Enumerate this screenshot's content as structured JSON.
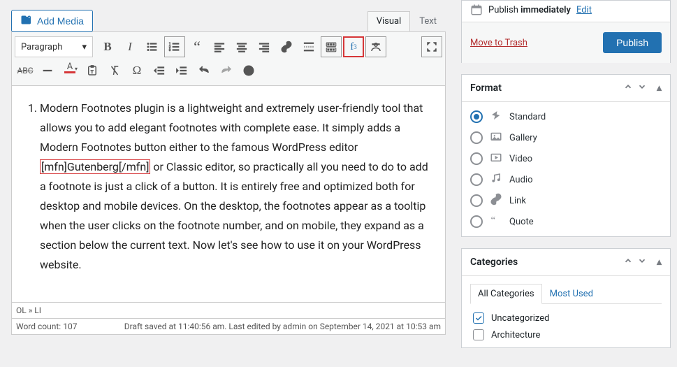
{
  "add_media_label": "Add Media",
  "editor_tabs": {
    "visual": "Visual",
    "text": "Text"
  },
  "paragraph_select": "Paragraph",
  "toolbar_icons": {
    "footnote_label": "f",
    "footnote_sup": "3"
  },
  "content": {
    "list_number": "1.",
    "text_before": "Modern Footnotes plugin is a lightweight and extremely user-friendly tool that allows you to add elegant footnotes with complete ease. It simply adds a Modern Footnotes button either to the famous WordPress editor ",
    "highlight": "[mfn]Gutenberg[/mfn]",
    "text_after": " or Classic editor, so practically all you need to do to add a footnote is just a click of a button. It is entirely free and optimized both for desktop and mobile devices. On the desktop, the footnotes appear as a tooltip when the user clicks on the footnote number, and on mobile, they expand as a section below the current text. Now let's see how to use it on your WordPress website."
  },
  "status": {
    "path": "OL » LI",
    "wordcount_label": "Word count:",
    "wordcount_value": "107",
    "save_info": "Draft saved at 11:40:56 am. Last edited by admin on September 14, 2021 at 10:53 am"
  },
  "publish": {
    "label_prefix": "Publish ",
    "label_value": "immediately",
    "edit": "Edit",
    "trash": "Move to Trash",
    "button": "Publish"
  },
  "format": {
    "title": "Format",
    "items": [
      {
        "key": "standard",
        "label": "Standard",
        "checked": true
      },
      {
        "key": "gallery",
        "label": "Gallery",
        "checked": false
      },
      {
        "key": "video",
        "label": "Video",
        "checked": false
      },
      {
        "key": "audio",
        "label": "Audio",
        "checked": false
      },
      {
        "key": "link",
        "label": "Link",
        "checked": false
      },
      {
        "key": "quote",
        "label": "Quote",
        "checked": false
      }
    ]
  },
  "categories": {
    "title": "Categories",
    "tabs": {
      "all": "All Categories",
      "most": "Most Used"
    },
    "items": [
      {
        "key": "uncategorized",
        "label": "Uncategorized",
        "checked": true
      },
      {
        "key": "architecture",
        "label": "Architecture",
        "checked": false
      }
    ]
  }
}
